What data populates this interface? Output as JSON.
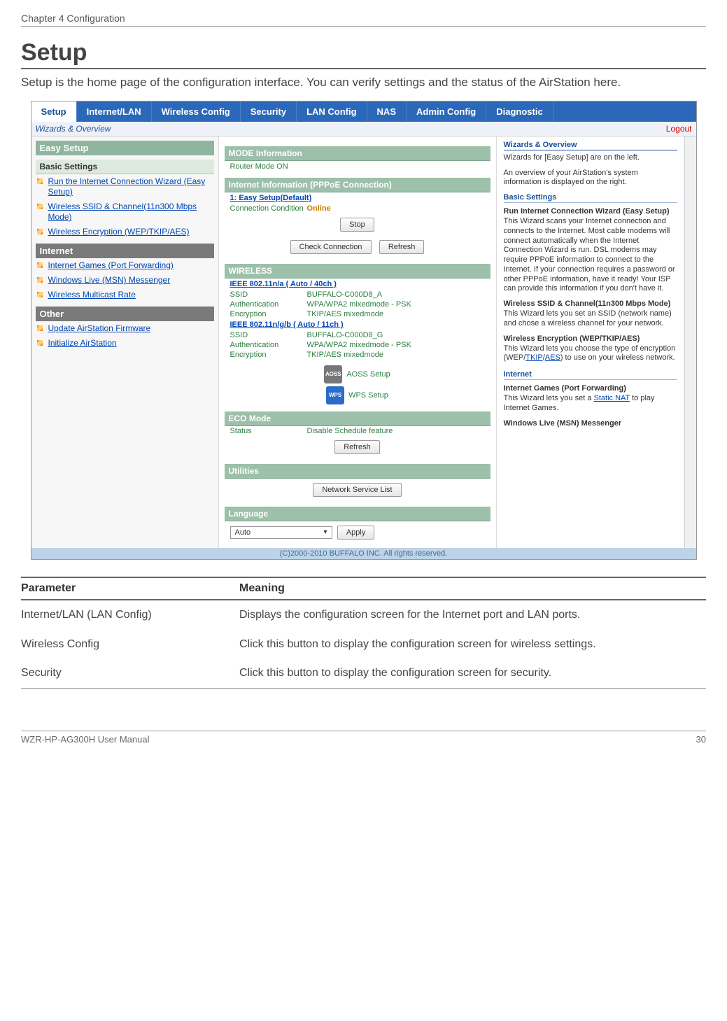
{
  "doc": {
    "chapter": "Chapter 4  Configuration",
    "section_title": "Setup",
    "intro": "Setup is the home page of the configuration interface. You can verify settings and the status of the AirStation here.",
    "footer_left": "WZR-HP-AG300H User Manual",
    "footer_right": "30"
  },
  "ui": {
    "tabs": [
      "Setup",
      "Internet/LAN",
      "Wireless Config",
      "Security",
      "LAN Config",
      "NAS",
      "Admin Config",
      "Diagnostic"
    ],
    "subtab": "Wizards & Overview",
    "logout": "Logout",
    "left": {
      "easy_head": "Easy Setup",
      "basic_head": "Basic Settings",
      "basic_links": [
        "Run the Internet Connection Wizard (Easy Setup)",
        "Wireless SSID & Channel(11n300 Mbps Mode)",
        "Wireless Encryption (WEP/TKIP/AES)"
      ],
      "internet_head": "Internet",
      "internet_links": [
        "Internet Games (Port Forwarding)",
        "Windows Live (MSN) Messenger",
        "Wireless Multicast Rate"
      ],
      "other_head": "Other",
      "other_links": [
        "Update AirStation Firmware",
        "Initialize AirStation"
      ]
    },
    "mid": {
      "mode_head": "MODE Information",
      "mode_val": "Router Mode ON",
      "inet_head": "Internet Information (PPPoE Connection)",
      "inet_sub": "1: Easy Setup(Default)",
      "conn_label": "Connection Condition",
      "conn_val": "Online",
      "btn_stop": "Stop",
      "btn_check": "Check Connection",
      "btn_refresh": "Refresh",
      "wl_head": "WIRELESS",
      "wl_a_head": "IEEE 802.11n/a ( Auto / 40ch )",
      "wl_a": {
        "ssid_k": "SSID",
        "ssid_v": "BUFFALO-C000D8_A",
        "auth_k": "Authentication",
        "auth_v": "WPA/WPA2 mixedmode - PSK",
        "enc_k": "Encryption",
        "enc_v": "TKIP/AES mixedmode"
      },
      "wl_g_head": "IEEE 802.11n/g/b ( Auto / 11ch )",
      "wl_g": {
        "ssid_k": "SSID",
        "ssid_v": "BUFFALO-C000D8_G",
        "auth_k": "Authentication",
        "auth_v": "WPA/WPA2 mixedmode - PSK",
        "enc_k": "Encryption",
        "enc_v": "TKIP/AES mixedmode"
      },
      "aoss_icon": "AOSS",
      "aoss_label": "AOSS Setup",
      "wps_icon": "WPS",
      "wps_label": "WPS Setup",
      "eco_head": "ECO Mode",
      "eco_status_k": "Status",
      "eco_status_v": "Disable Schedule feature",
      "eco_refresh": "Refresh",
      "util_head": "Utilities",
      "util_btn": "Network Service List",
      "lang_head": "Language",
      "lang_val": "Auto",
      "lang_apply": "Apply"
    },
    "right": {
      "head": "Wizards & Overview",
      "p1": "Wizards for [Easy Setup] are on the left.",
      "p2": "An overview of your AirStation's system information is displayed on the right.",
      "basic_head": "Basic Settings",
      "r1_head": "Run Internet Connection Wizard (Easy Setup)",
      "r1_body": "This Wizard scans your Internet connection and connects to the Internet. Most cable modems will connect automatically when the Internet Connection Wizard is run. DSL modems may require PPPoE information to connect to the Internet. If your connection requires a password or other PPPoE information, have it ready! Your ISP can provide this information if you don't have it.",
      "r2_head": "Wireless SSID & Channel(11n300 Mbps Mode)",
      "r2_body": "This Wizard lets you set an SSID (network name) and chose a wireless channel for your network.",
      "r3_head": "Wireless Encryption (WEP/TKIP/AES)",
      "r3_prefix": "This Wizard lets you choose the type of encryption (WEP/",
      "r3_link1": "TKIP",
      "r3_mid": "/",
      "r3_link2": "AES",
      "r3_suffix": ") to use on your wireless network.",
      "inet_head": "Internet",
      "r4_head": "Internet Games (Port Forwarding)",
      "r4_prefix": "This Wizard lets you set a ",
      "r4_link": "Static NAT",
      "r4_suffix": " to play Internet Games.",
      "r5_head": "Windows Live (MSN) Messenger"
    },
    "copyright": "(C)2000-2010 BUFFALO INC. All rights reserved."
  },
  "table": {
    "h1": "Parameter",
    "h2": "Meaning",
    "rows": [
      {
        "p": "Internet/LAN (LAN Config)",
        "m": "Displays the configuration screen for the Internet port and LAN ports."
      },
      {
        "p": "Wireless Config",
        "m": "Click this button to display the configuration screen for wireless settings."
      },
      {
        "p": "Security",
        "m": "Click this button to display the configuration screen for security."
      }
    ]
  }
}
